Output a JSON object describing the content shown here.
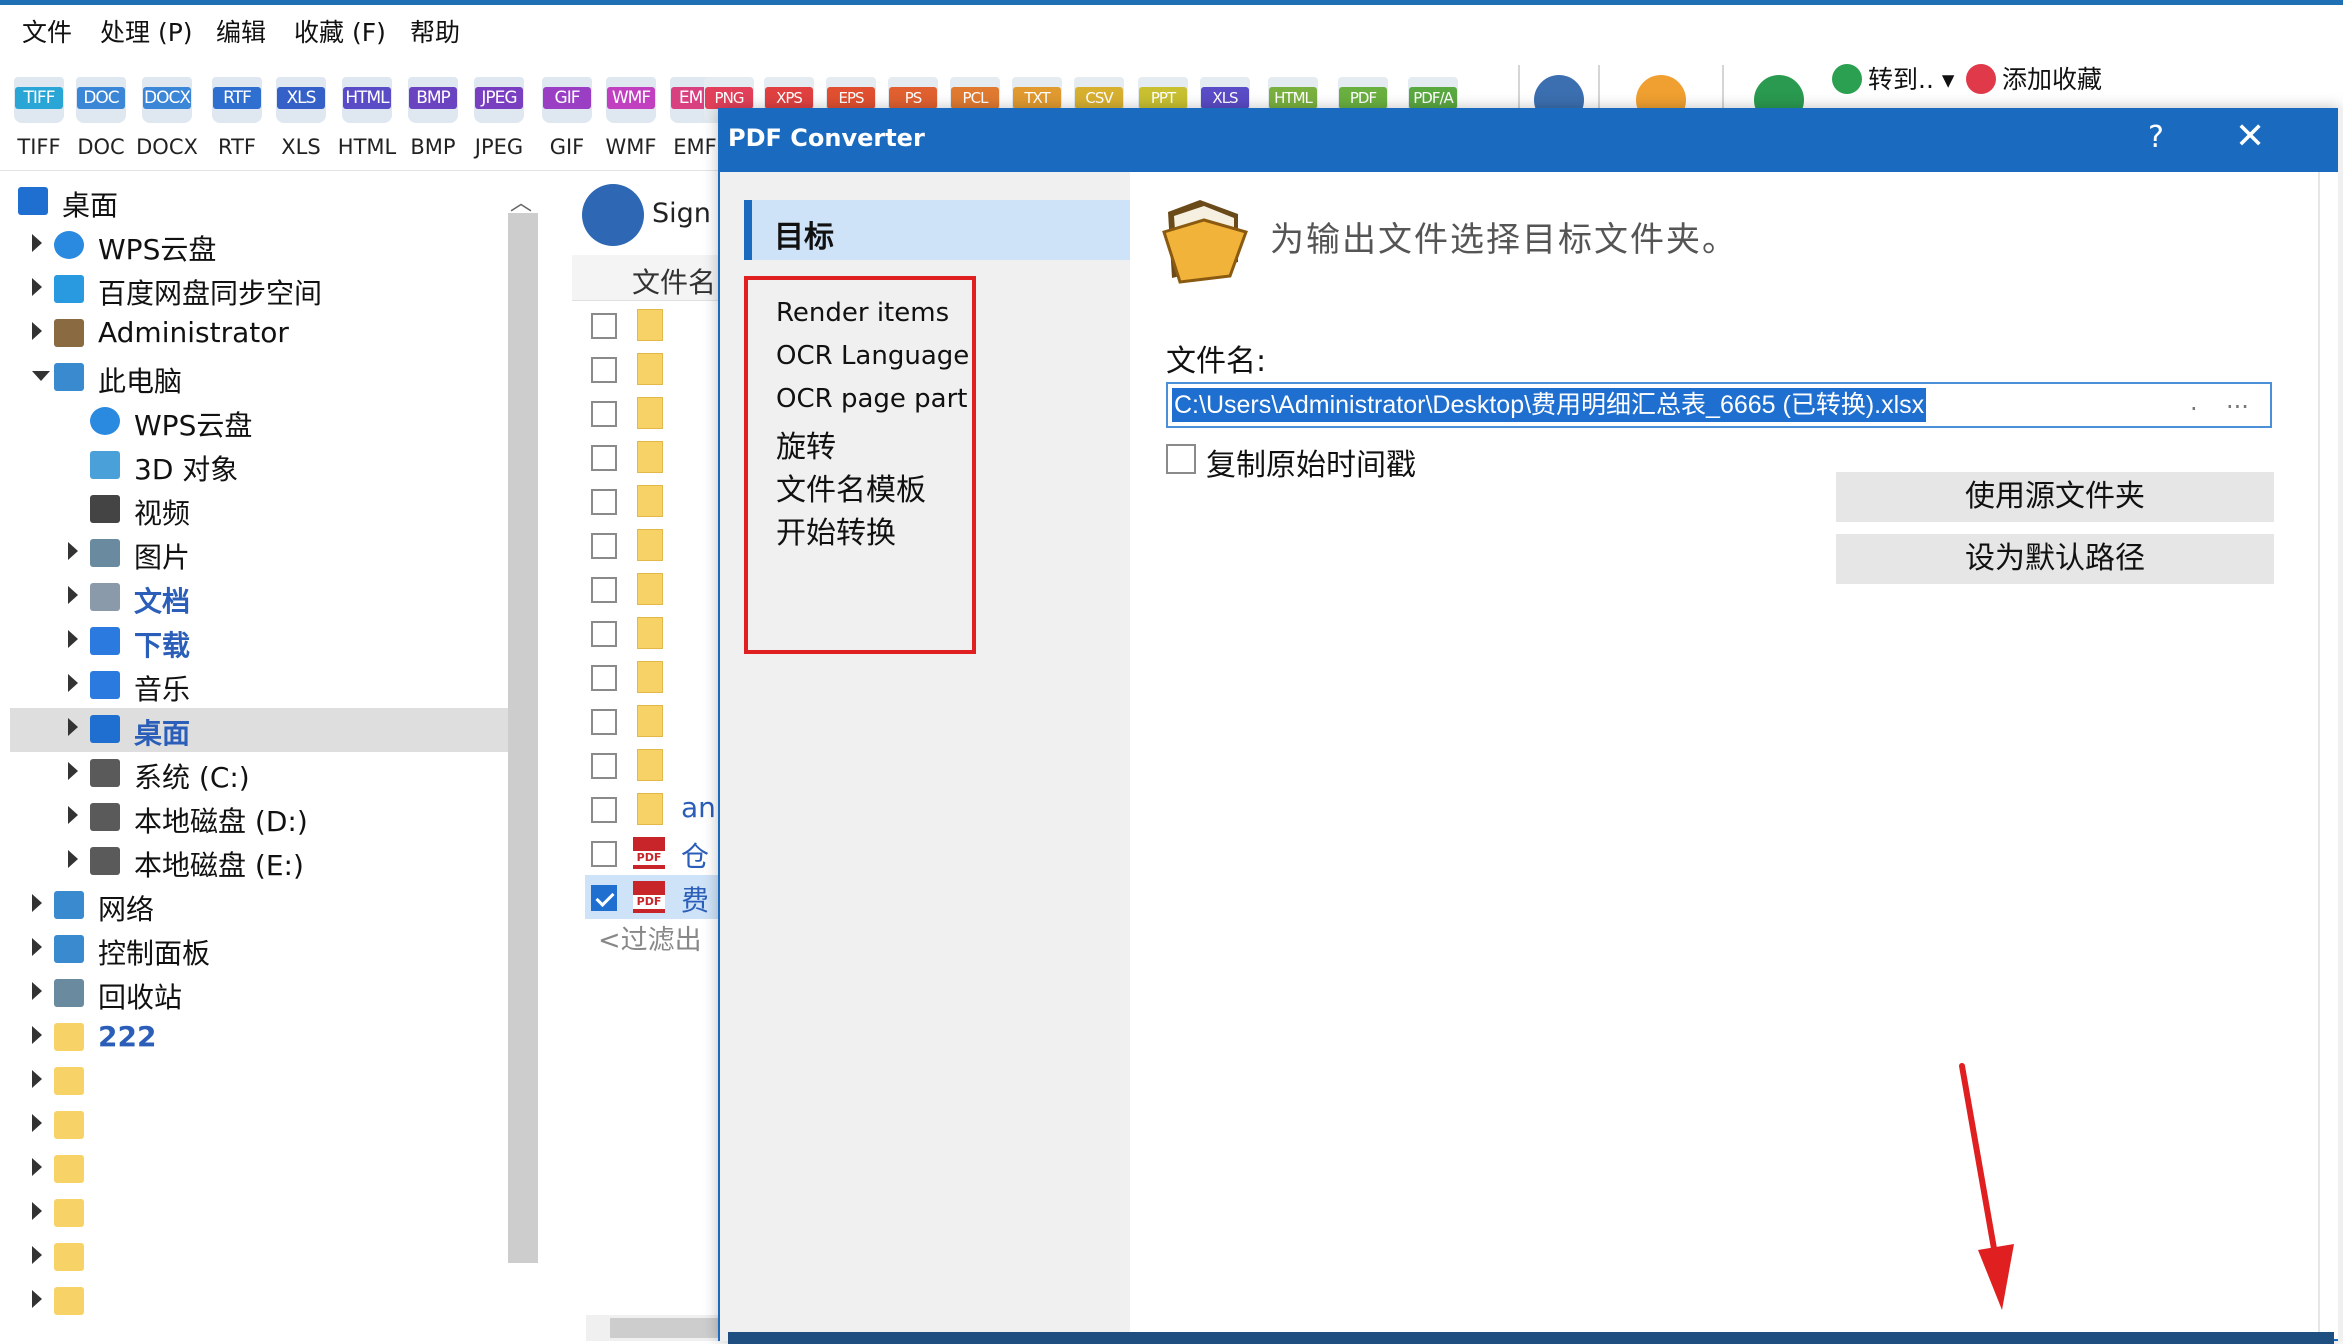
{
  "menu": [
    "文件",
    "处理 (P)",
    "编辑",
    "收藏 (F)",
    "帮助"
  ],
  "toolbar": {
    "formats": [
      {
        "tag": "TIFF",
        "label": "TIFF",
        "color": "#2aa6d6"
      },
      {
        "tag": "DOC",
        "label": "DOC",
        "color": "#3b86d6"
      },
      {
        "tag": "DOCX",
        "label": "DOCX",
        "color": "#3b86d6"
      },
      {
        "tag": "RTF",
        "label": "RTF",
        "color": "#2f6fd0"
      },
      {
        "tag": "XLS",
        "label": "XLS",
        "color": "#3460c8"
      },
      {
        "tag": "HTML",
        "label": "HTML",
        "color": "#5a4bc6"
      },
      {
        "tag": "BMP",
        "label": "BMP",
        "color": "#6a43c0"
      },
      {
        "tag": "JPEG",
        "label": "JPEG",
        "color": "#7a3fc0"
      },
      {
        "tag": "GIF",
        "label": "GIF",
        "color": "#9a3fc4"
      },
      {
        "tag": "WMF",
        "label": "WMF",
        "color": "#c040c0"
      },
      {
        "tag": "EMF",
        "label": "EMF",
        "color": "#d84080"
      }
    ],
    "hidden_formats": [
      {
        "tag": "PNG",
        "color": "#e2405a"
      },
      {
        "tag": "XPS",
        "color": "#e04040"
      },
      {
        "tag": "EPS",
        "color": "#e05030"
      },
      {
        "tag": "PS",
        "color": "#e06030"
      },
      {
        "tag": "PCL",
        "color": "#e07a30"
      },
      {
        "tag": "TXT",
        "color": "#e09a30"
      },
      {
        "tag": "CSV",
        "color": "#d8b030"
      },
      {
        "tag": "PPT",
        "color": "#c8c030"
      },
      {
        "tag": "XLS",
        "color": "#5a4bc6"
      },
      {
        "tag": "HTML",
        "color": "#7ab040"
      },
      {
        "tag": "PDF",
        "color": "#6ab040"
      },
      {
        "tag": "PDF/A",
        "color": "#5aa840"
      }
    ],
    "goto_label": "转到..",
    "favorite_label": "添加收藏"
  },
  "tree": {
    "items": [
      {
        "label": "桌面",
        "level": 0,
        "arrow": "none",
        "icon": "desktop-icon",
        "bold": false
      },
      {
        "label": "WPS云盘",
        "level": 1,
        "arrow": "closed",
        "icon": "cloud-icon",
        "bold": false
      },
      {
        "label": "百度网盘同步空间",
        "level": 1,
        "arrow": "closed",
        "icon": "baidu-icon",
        "bold": false
      },
      {
        "label": "Administrator",
        "level": 1,
        "arrow": "closed",
        "icon": "user-icon",
        "bold": false
      },
      {
        "label": "此电脑",
        "level": 1,
        "arrow": "open",
        "icon": "computer-icon",
        "bold": false
      },
      {
        "label": "WPS云盘",
        "level": 2,
        "arrow": "none",
        "icon": "cloud-icon",
        "bold": false
      },
      {
        "label": "3D 对象",
        "level": 2,
        "arrow": "none",
        "icon": "cube-icon",
        "bold": false
      },
      {
        "label": "视频",
        "level": 2,
        "arrow": "none",
        "icon": "video-icon",
        "bold": false
      },
      {
        "label": "图片",
        "level": 2,
        "arrow": "closed",
        "icon": "picture-icon",
        "bold": false
      },
      {
        "label": "文档",
        "level": 2,
        "arrow": "closed",
        "icon": "document-icon",
        "bold": true
      },
      {
        "label": "下载",
        "level": 2,
        "arrow": "closed",
        "icon": "download-icon",
        "bold": true
      },
      {
        "label": "音乐",
        "level": 2,
        "arrow": "closed",
        "icon": "music-icon",
        "bold": false
      },
      {
        "label": "桌面",
        "level": 2,
        "arrow": "closed",
        "icon": "desktop-icon",
        "bold": true
      },
      {
        "label": "系统 (C:)",
        "level": 2,
        "arrow": "closed",
        "icon": "drive-icon",
        "bold": false
      },
      {
        "label": "本地磁盘 (D:)",
        "level": 2,
        "arrow": "closed",
        "icon": "drive-icon",
        "bold": false
      },
      {
        "label": "本地磁盘 (E:)",
        "level": 2,
        "arrow": "closed",
        "icon": "drive-icon",
        "bold": false
      },
      {
        "label": "网络",
        "level": 1,
        "arrow": "closed",
        "icon": "network-icon",
        "bold": false
      },
      {
        "label": "控制面板",
        "level": 1,
        "arrow": "closed",
        "icon": "control-panel-icon",
        "bold": false
      },
      {
        "label": "回收站",
        "level": 1,
        "arrow": "closed",
        "icon": "recycle-bin-icon",
        "bold": false
      },
      {
        "label": "222",
        "level": 1,
        "arrow": "closed",
        "icon": "folder-icon",
        "bold": true
      },
      {
        "label": "",
        "level": 1,
        "arrow": "closed",
        "icon": "folder-icon",
        "bold": false
      },
      {
        "label": "",
        "level": 1,
        "arrow": "closed",
        "icon": "folder-icon",
        "bold": false
      },
      {
        "label": "",
        "level": 1,
        "arrow": "closed",
        "icon": "folder-icon",
        "bold": false
      },
      {
        "label": "",
        "level": 1,
        "arrow": "closed",
        "icon": "folder-icon",
        "bold": false
      },
      {
        "label": "",
        "level": 1,
        "arrow": "closed",
        "icon": "folder-icon",
        "bold": false
      },
      {
        "label": "",
        "level": 1,
        "arrow": "closed",
        "icon": "folder-icon",
        "bold": false
      }
    ]
  },
  "filelist": {
    "sign_label": "Sign",
    "column_header": "文件名",
    "rows": [
      {
        "type": "folder",
        "checked": false,
        "name": ""
      },
      {
        "type": "folder",
        "checked": false,
        "name": ""
      },
      {
        "type": "folder",
        "checked": false,
        "name": ""
      },
      {
        "type": "folder",
        "checked": false,
        "name": ""
      },
      {
        "type": "folder",
        "checked": false,
        "name": ""
      },
      {
        "type": "folder",
        "checked": false,
        "name": ""
      },
      {
        "type": "folder",
        "checked": false,
        "name": ""
      },
      {
        "type": "folder",
        "checked": false,
        "name": ""
      },
      {
        "type": "folder",
        "checked": false,
        "name": ""
      },
      {
        "type": "folder",
        "checked": false,
        "name": ""
      },
      {
        "type": "folder",
        "checked": false,
        "name": ""
      },
      {
        "type": "folder",
        "checked": false,
        "name": "an"
      },
      {
        "type": "pdf",
        "checked": false,
        "name": "仓"
      },
      {
        "type": "pdf",
        "checked": true,
        "name": "费"
      }
    ],
    "filter_text": "<过滤出"
  },
  "dialog": {
    "title": "PDF Converter",
    "help": "?",
    "close": "✕",
    "nav_active": "目标",
    "nav_items": [
      "Render items",
      "OCR Language",
      "OCR page part",
      "旋转",
      "文件名模板",
      "开始转换"
    ],
    "heading": "为输出文件选择目标文件夹。",
    "filename_label": "文件名:",
    "filename_value": "C:\\Users\\Administrator\\Desktop\\费用明细汇总表_6665 (已转换).xlsx",
    "dot_button": ".",
    "browse_button": "...",
    "copy_timestamp_label": "复制原始时间戳",
    "copy_timestamp_checked": false,
    "use_source_folder": "使用源文件夹",
    "set_default_path": "设为默认路径"
  }
}
